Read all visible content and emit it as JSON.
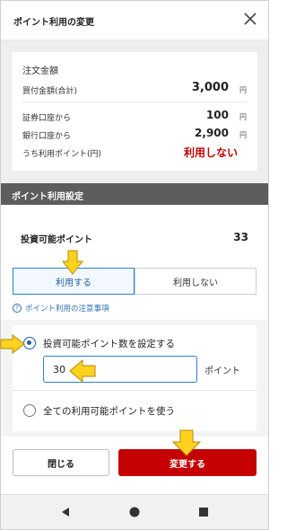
{
  "header": {
    "title": "ポイント利用の変更"
  },
  "order": {
    "heading": "注文金額",
    "rows": [
      {
        "label": "買付金額(合計)",
        "value": "3,000",
        "unit": "円"
      },
      {
        "label": "証券口座から",
        "value": "100",
        "unit": "円"
      },
      {
        "label": "銀行口座から",
        "value": "2,900",
        "unit": "円"
      },
      {
        "label": "うち利用ポイント(円)",
        "value": "利用しない",
        "unit": ""
      }
    ]
  },
  "section": {
    "title": "ポイント利用設定"
  },
  "points": {
    "label": "投資可能ポイント",
    "value": "33"
  },
  "segment": {
    "use": "利用する",
    "not_use": "利用しない",
    "selected": "use"
  },
  "note": {
    "text": "ポイント利用の注意事項"
  },
  "options": {
    "set_amount": "投資可能ポイント数を設定する",
    "input_value": "30",
    "unit": "ポイント",
    "use_all": "全ての利用可能ポイントを使う",
    "selected": "set_amount"
  },
  "footer": {
    "close": "閉じる",
    "change": "変更する"
  },
  "colors": {
    "accent_red": "#c40000",
    "accent_blue": "#2a7fd0",
    "arrow_yellow": "#ffd21f"
  },
  "navbar": {
    "icons": [
      "back-icon",
      "home-icon",
      "recents-icon"
    ]
  }
}
